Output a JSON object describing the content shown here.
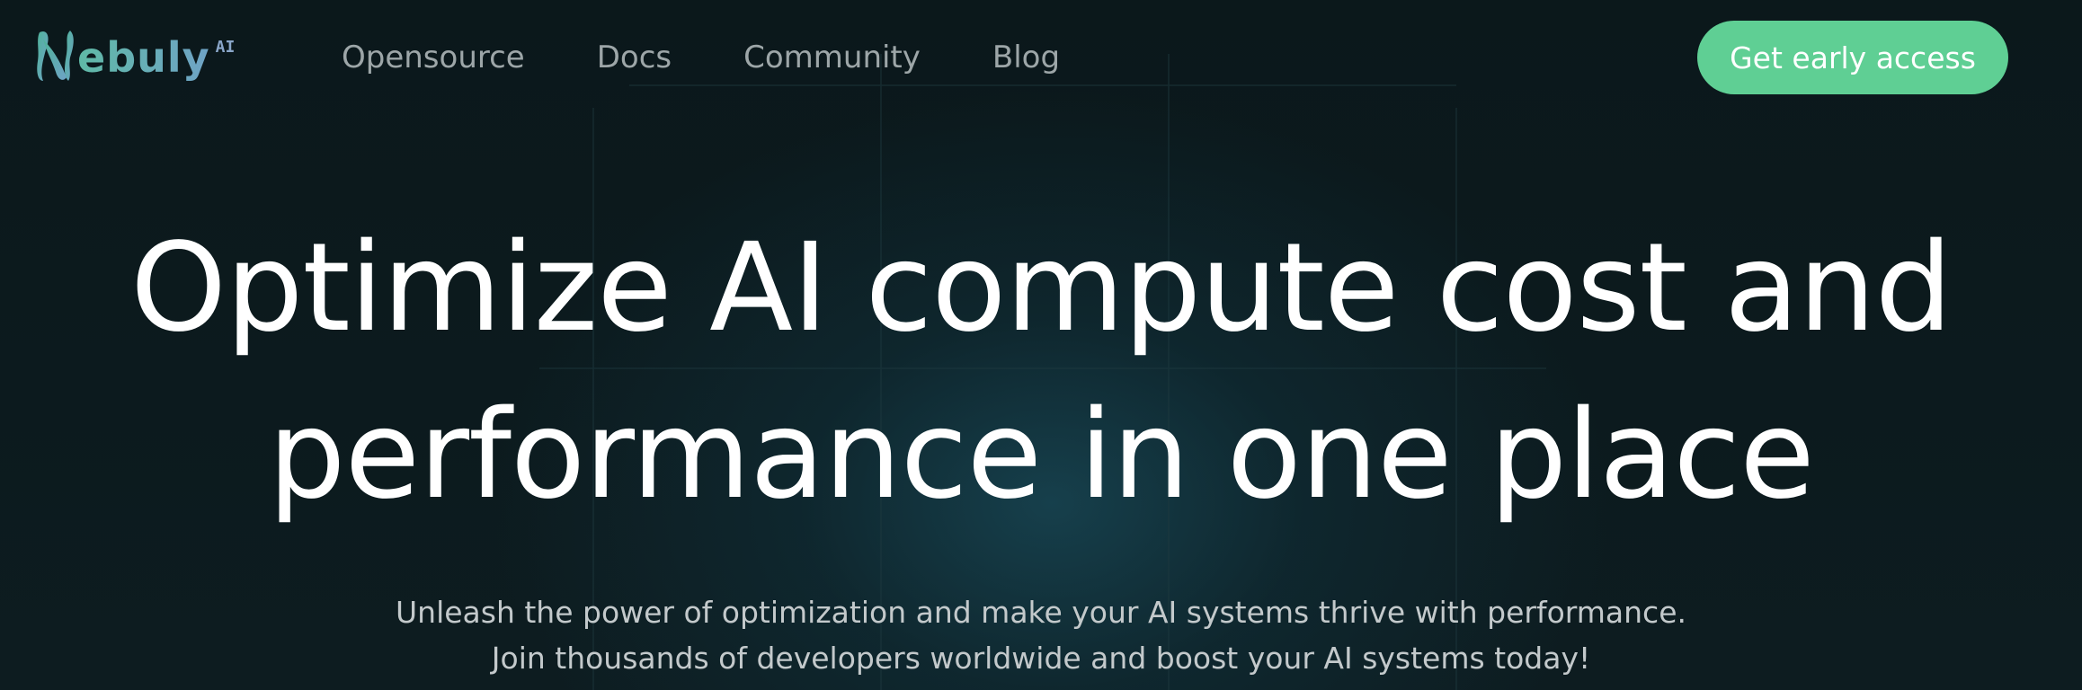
{
  "brand": {
    "name": "ebuly",
    "suffix": "AI",
    "logo_icon": "nebuly-n-logo-icon"
  },
  "nav": {
    "items": [
      {
        "label": "Opensource"
      },
      {
        "label": "Docs"
      },
      {
        "label": "Community"
      },
      {
        "label": "Blog"
      }
    ],
    "cta_label": "Get early access"
  },
  "hero": {
    "title_lines": [
      "Optimize AI compute cost and",
      "performance in one place"
    ],
    "subtitle_lines": [
      "Unleash the power of optimization and make your AI systems thrive with performance.",
      "Join thousands of developers worldwide and boost your AI systems today!"
    ]
  },
  "colors": {
    "background": "#0b181b",
    "accent": "#5fcf94",
    "nav_text": "#9da6a8",
    "logo_gradient_start": "#5fb9a6",
    "logo_gradient_end": "#6fa3c6"
  }
}
